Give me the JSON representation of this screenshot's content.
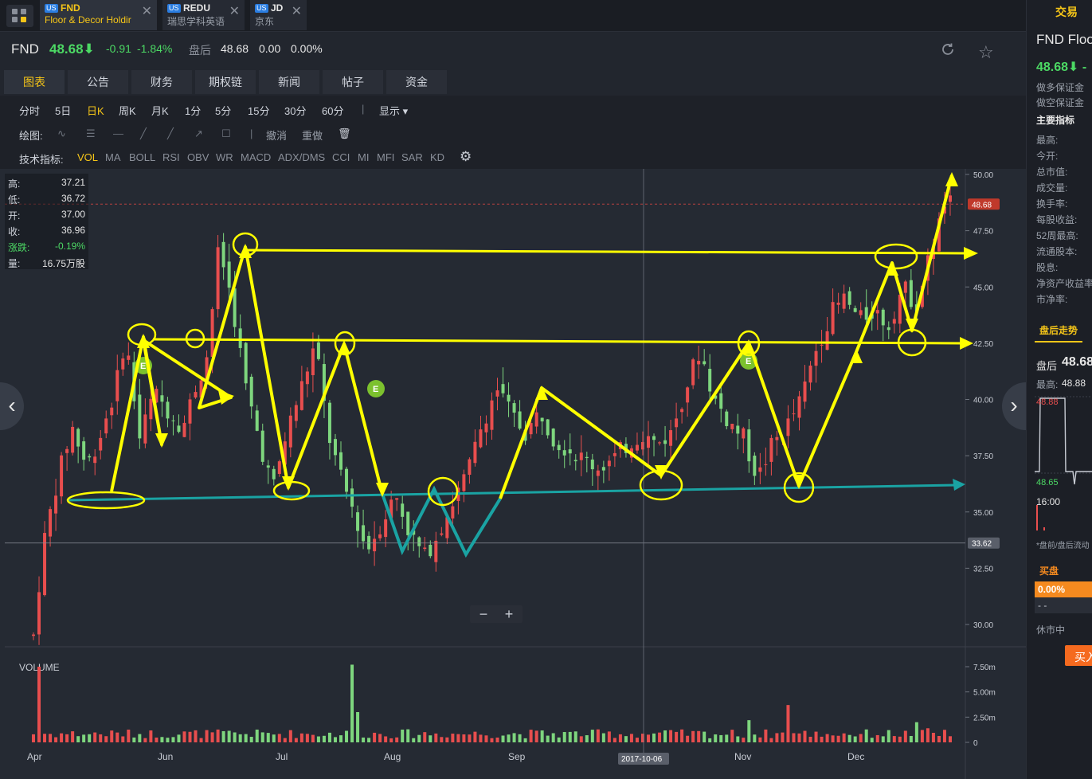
{
  "tabs": [
    {
      "market": "US",
      "symbol": "FND",
      "name": "Floor & Decor Holdir",
      "active": true
    },
    {
      "market": "US",
      "symbol": "REDU",
      "name": "瑞思学科英语",
      "active": false
    },
    {
      "market": "US",
      "symbol": "JD",
      "name": "京东",
      "active": false
    }
  ],
  "quote": {
    "symbol": "FND",
    "price": "48.68⬇",
    "change": "-0.91",
    "change_pct": "-1.84%",
    "after_hours_label": "盘后",
    "after_hours_price": "48.68",
    "after_hours_change": "0.00",
    "after_hours_pct": "0.00%"
  },
  "main_tabs": [
    "图表",
    "公告",
    "财务",
    "期权链",
    "新闻",
    "帖子",
    "资金"
  ],
  "periods": [
    "分时",
    "5日",
    "日K",
    "周K",
    "月K",
    "1分",
    "5分",
    "15分",
    "30分",
    "60分",
    "显示 ▾"
  ],
  "active_period": "日K",
  "draw": {
    "label": "绘图:",
    "undo": "撤消",
    "redo": "重做"
  },
  "indicators": {
    "label": "技术指标:",
    "items": [
      "VOL",
      "MA",
      "BOLL",
      "RSI",
      "OBV",
      "WR",
      "MACD",
      "ADX/DMS",
      "CCI",
      "MI",
      "MFI",
      "SAR",
      "KD"
    ],
    "active": "VOL"
  },
  "ohlc": {
    "high_label": "高:",
    "high": "37.21",
    "low_label": "低:",
    "low": "36.72",
    "open_label": "开:",
    "open": "37.00",
    "close_label": "收:",
    "close": "36.96",
    "chg_label": "涨跌:",
    "chg": "-0.19%",
    "vol_label": "量:",
    "vol": "16.75万股"
  },
  "chart_data": {
    "type": "candlestick",
    "y_ticks": [
      "50.00",
      "47.50",
      "45.00",
      "42.50",
      "40.00",
      "37.50",
      "35.00",
      "32.50",
      "30.00"
    ],
    "ylim": [
      29.0,
      50.5
    ],
    "x_labels": [
      "Apr",
      "Jun",
      "Jul",
      "Aug",
      "Sep",
      "Nov",
      "Dec"
    ],
    "current_price_tag": "48.68",
    "crosshair_price": "33.62",
    "crosshair_date": "2017-10-06",
    "volume_label": "VOLUME",
    "volume_ticks": [
      "7.50m",
      "5.00m",
      "2.50m",
      "0"
    ],
    "marker_label": "E",
    "colors": {
      "up": "#e84e4e",
      "down": "#7ed67e",
      "annotation": "#ffff00",
      "support": "#1aa3a3"
    }
  },
  "right_panel": {
    "trade_label": "交易",
    "name": "FND Floo",
    "price": "48.68⬇ -",
    "long_margin": "做多保证金",
    "short_margin": "做空保证金",
    "key_indicators": "主要指标",
    "fields": [
      "最高:",
      "今开:",
      "总市值:",
      "成交量:",
      "换手率:",
      "每股收益:",
      "52周最高:",
      "流通股本:",
      "股息:",
      "净资产收益率",
      "市净率:"
    ],
    "after_trend": "盘后走势",
    "ah_label": "盘后",
    "ah_price": "48.68",
    "ah_high_label": "最高:",
    "ah_high": "48.88",
    "mini_top": "48.88",
    "mini_bottom": "48.65",
    "mini_time": "16:00",
    "note": "*盘前/盘后流动",
    "buy_label": "买盘",
    "buy_pct": "0.00%",
    "buy_dash": "- -",
    "closed": "休市中",
    "buy_btn": "买入"
  }
}
